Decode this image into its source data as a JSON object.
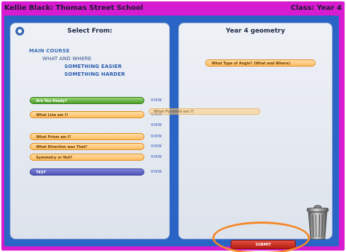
{
  "header": {
    "user_school": "Kellie Black:  Thomas Street School",
    "class_label": "Class: Year 4"
  },
  "left_panel": {
    "title": "Select From:",
    "courses": [
      "MAIN COURSE",
      "WHAT AND WHERE",
      "SOMETHING EASIER",
      "SOMETHING HARDER"
    ],
    "tasks": [
      {
        "label": "Are You Ready?",
        "color": "green"
      },
      {
        "label": "What Line am I?",
        "color": "orange"
      },
      {
        "label": "What Prism am I?",
        "color": "orange"
      },
      {
        "label": "What Direction was That?",
        "color": "orange"
      },
      {
        "label": "Symmetry or Not?",
        "color": "orange"
      },
      {
        "label": "TEST",
        "color": "blue"
      }
    ],
    "view_label": "VIEW"
  },
  "right_panel": {
    "title": "Year 4 geometry",
    "assigned_task": "What Type of Angle? (What and Where)"
  },
  "drag_ghost_label": "What Pyramid am I?",
  "submit_label": "SUBMIT",
  "colors": {
    "frame": "#d61bd0",
    "stage": "#2a64c4",
    "orange_task": "#ffbd62",
    "green_task": "#4a9d2a",
    "blue_task": "#4c52b3",
    "submit": "#c8261a",
    "highlight_ring": "#f4882a"
  }
}
